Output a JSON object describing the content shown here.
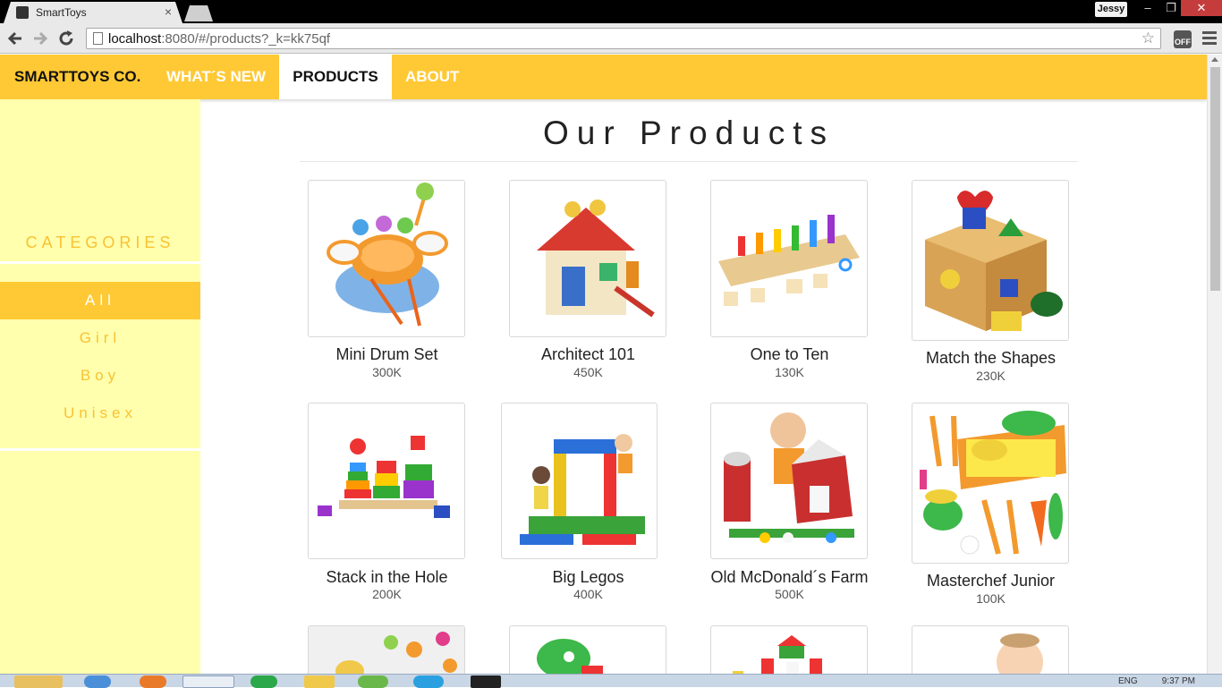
{
  "browser": {
    "tab_title": "SmartToys",
    "tab_close": "×",
    "user": "Jessy",
    "url_host": "localhost",
    "url_rest": ":8080/#/products?_k=kk75qf",
    "minimize": "–",
    "restore": "❐",
    "close": "✕"
  },
  "nav": {
    "brand": "SMARTTOYS CO.",
    "whats_new": "WHAT´S NEW",
    "products": "PRODUCTS",
    "about": "ABOUT"
  },
  "sidebar": {
    "title": "CATEGORIES",
    "items": [
      {
        "label": "All",
        "active": true
      },
      {
        "label": "Girl",
        "active": false
      },
      {
        "label": "Boy",
        "active": false
      },
      {
        "label": "Unisex",
        "active": false
      }
    ]
  },
  "main": {
    "heading": "Our Products",
    "products": [
      {
        "name": "Mini Drum Set",
        "price": "300K"
      },
      {
        "name": "Architect 101",
        "price": "450K"
      },
      {
        "name": "One to Ten",
        "price": "130K"
      },
      {
        "name": "Match the Shapes",
        "price": "230K"
      },
      {
        "name": "Stack in the Hole",
        "price": "200K"
      },
      {
        "name": "Big Legos",
        "price": "400K"
      },
      {
        "name": "Old McDonald´s Farm",
        "price": "500K"
      },
      {
        "name": "Masterchef Junior",
        "price": "100K"
      }
    ]
  },
  "taskbar": {
    "lang": "ENG",
    "clock": "9:37 PM"
  },
  "colors": {
    "accent": "#ffc935",
    "sidebar_bg": "#ffffad",
    "category_text": "#f9c232"
  }
}
